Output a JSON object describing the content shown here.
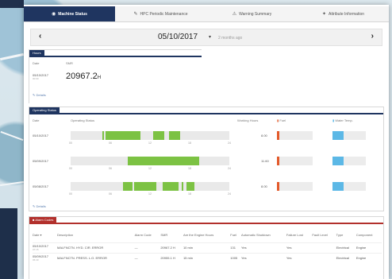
{
  "tabs": [
    {
      "label": "Machine Status",
      "icon": "gauge-icon",
      "active": true
    },
    {
      "label": "HPC Periodic Maintenance",
      "icon": "wrench-icon",
      "active": false
    },
    {
      "label": "Warning Summary",
      "icon": "warning-icon",
      "active": false
    },
    {
      "label": "Attribute Information",
      "icon": "tag-icon",
      "active": false
    }
  ],
  "date_nav": {
    "date": "05/10/2017",
    "relative": "2 months ago",
    "prev": "‹",
    "next": "›"
  },
  "hours_section": {
    "tag": "Hours",
    "date_label": "Date",
    "smr_label": "SMR",
    "date": "05/10/2017",
    "time": "00:00",
    "value": "20967.2",
    "unit": "H",
    "link": "Details"
  },
  "operating_section": {
    "tag": "Operating Status",
    "col_date": "Date",
    "col_status": "Operating Status",
    "col_hours": "Working Hours",
    "col_fuel": "Fuel",
    "col_temp": "Water Temp.",
    "ticks": [
      "00",
      "06",
      "12",
      "18",
      "24"
    ],
    "rows": [
      {
        "date": "05/10/2017",
        "segments": [
          [
            0.2,
            0.21
          ],
          [
            0.22,
            0.44
          ],
          [
            0.52,
            0.59
          ],
          [
            0.62,
            0.69
          ]
        ],
        "hours": "8.00",
        "fuel": 0.05,
        "temp": 0.33
      },
      {
        "date": "05/09/2017",
        "segments": [
          [
            0.36,
            0.81
          ]
        ],
        "hours": "11.60",
        "fuel": 0.05,
        "temp": 0.33
      },
      {
        "date": "05/08/2017",
        "segments": [
          [
            0.33,
            0.39
          ],
          [
            0.4,
            0.42
          ],
          [
            0.42,
            0.54
          ],
          [
            0.58,
            0.68
          ],
          [
            0.7,
            0.71
          ],
          [
            0.73,
            0.78
          ]
        ],
        "hours": "8.00",
        "fuel": 0.05,
        "temp": 0.33
      }
    ],
    "link": "Details"
  },
  "alarm_section": {
    "tag": "Alarm Codes",
    "headers": [
      "Date ▾",
      "Description",
      "Alarm Code",
      "SMR",
      "Are the Engine Hours",
      "Fuel",
      "Automatic Shutdown",
      "Failure Lost",
      "Fault Level",
      "Type",
      "Component"
    ],
    "rows": [
      {
        "date": "05/10/2017",
        "time": "07:15",
        "description": "MALFNCTN. HYD. CIR. ERROR",
        "code": "—",
        "smr": "20967.2 H",
        "engine": "10 min",
        "fuel": "131",
        "auto": "Yes",
        "lost": "Yes",
        "level": "",
        "type": "Electrical",
        "component": "Engine"
      },
      {
        "date": "05/09/2017",
        "time": "06:40",
        "description": "MALFNCTN. PRESS. L.O. ERROR",
        "code": "—",
        "smr": "20955.1 H",
        "engine": "15 min",
        "fuel": "1005",
        "auto": "Yes",
        "lost": "Yes",
        "level": "",
        "type": "Electrical",
        "component": "Engine"
      }
    ]
  }
}
